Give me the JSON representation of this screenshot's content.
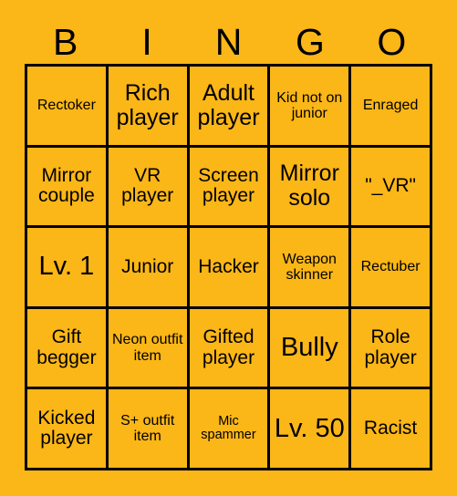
{
  "card": {
    "title": "BINGO",
    "background_color": "#FBB617",
    "border_color": "#000000",
    "text_color": "#000000",
    "header_letters": [
      "B",
      "I",
      "N",
      "G",
      "O"
    ],
    "columns": 5,
    "rows": 5,
    "cells": [
      [
        {
          "text": "Rectoker",
          "size": "sm"
        },
        {
          "text": "Rich player",
          "size": "lg"
        },
        {
          "text": "Adult player",
          "size": "lg"
        },
        {
          "text": "Kid not on junior",
          "size": "sm"
        },
        {
          "text": "Enraged",
          "size": "sm"
        }
      ],
      [
        {
          "text": "Mirror couple",
          "size": "md"
        },
        {
          "text": "VR player",
          "size": "md"
        },
        {
          "text": "Screen player",
          "size": "md"
        },
        {
          "text": "Mirror solo",
          "size": "lg"
        },
        {
          "text": "\"_VR\"",
          "size": "md"
        }
      ],
      [
        {
          "text": "Lv. 1",
          "size": "xl"
        },
        {
          "text": "Junior",
          "size": "md"
        },
        {
          "text": "Hacker",
          "size": "md"
        },
        {
          "text": "Weapon skinner",
          "size": "sm"
        },
        {
          "text": "Rectuber",
          "size": "sm"
        }
      ],
      [
        {
          "text": "Gift begger",
          "size": "md"
        },
        {
          "text": "Neon outfit item",
          "size": "sm"
        },
        {
          "text": "Gifted player",
          "size": "md"
        },
        {
          "text": "Bully",
          "size": "xl"
        },
        {
          "text": "Role player",
          "size": "md"
        }
      ],
      [
        {
          "text": "Kicked player",
          "size": "md"
        },
        {
          "text": "S+ outfit item",
          "size": "sm"
        },
        {
          "text": "Mic spammer",
          "size": "xs"
        },
        {
          "text": "Lv. 50",
          "size": "xl"
        },
        {
          "text": "Racist",
          "size": "md"
        }
      ]
    ]
  }
}
